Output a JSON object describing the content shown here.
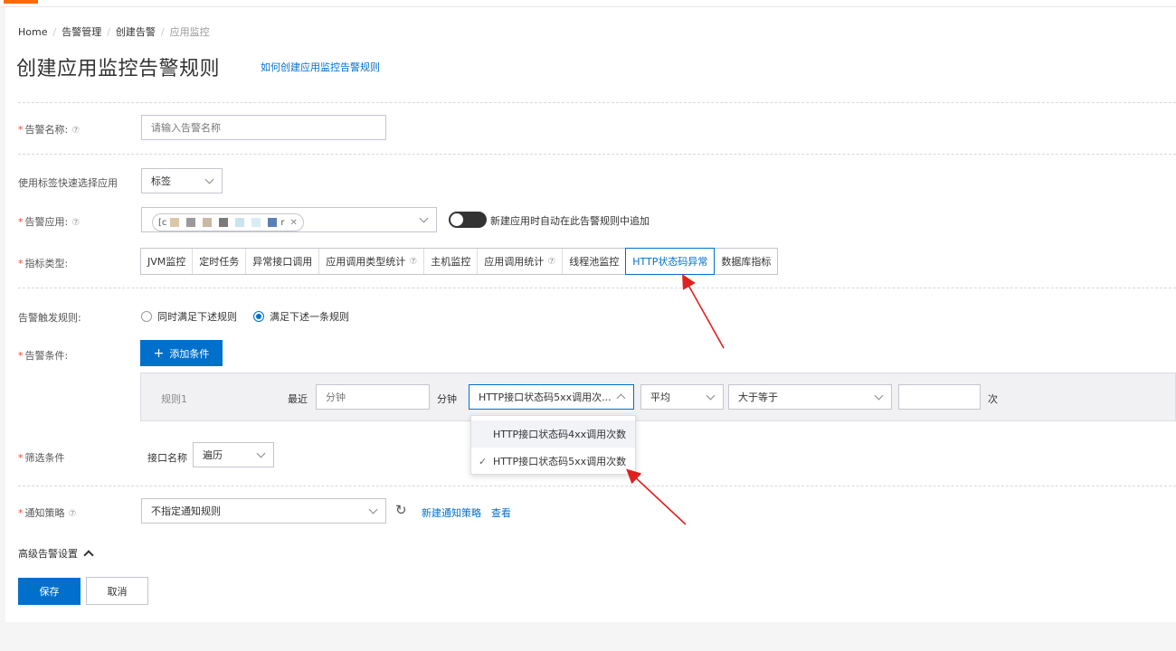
{
  "breadcrumb": {
    "items": [
      "Home",
      "告警管理",
      "创建告警",
      "应用监控"
    ]
  },
  "page": {
    "title": "创建应用监控告警规则",
    "help_link": "如何创建应用监控告警规则"
  },
  "form": {
    "alert_name": {
      "label": "告警名称:",
      "placeholder": "请输入告警名称"
    },
    "tag_select": {
      "label": "使用标签快速选择应用",
      "value": "标签"
    },
    "alert_app": {
      "label": "告警应用:",
      "tag_prefix": "[c",
      "tag_suffix": "r",
      "toggle_label": "新建应用时自动在此告警规则中追加"
    },
    "metric_type": {
      "label": "指标类型:",
      "tabs": [
        "JVM监控",
        "定时任务",
        "异常接口调用",
        "应用调用类型统计",
        "主机监控",
        "应用调用统计",
        "线程池监控",
        "HTTP状态码异常",
        "数据库指标"
      ],
      "active": "HTTP状态码异常"
    },
    "trigger_rule": {
      "label": "告警触发规则:",
      "option_all": "同时满足下述规则",
      "option_any": "满足下述一条规则"
    },
    "condition": {
      "label": "告警条件:",
      "add_button": "添加条件",
      "rule": {
        "name": "规则1",
        "recent_label": "最近",
        "minutes_placeholder": "分钟",
        "minutes_unit": "分钟",
        "metric_value": "HTTP接口状态码5xx调用次...",
        "agg_value": "平均",
        "op_value": "大于等于",
        "count_unit": "次"
      },
      "dropdown_options": [
        "HTTP接口状态码4xx调用次数",
        "HTTP接口状态码5xx调用次数"
      ]
    },
    "filter": {
      "label": "筛选条件",
      "field_label": "接口名称",
      "value": "遍历"
    },
    "notify": {
      "label": "通知策略",
      "value": "不指定通知规则",
      "new_link": "新建通知策略",
      "view_link": "查看"
    },
    "advanced": {
      "label": "高级告警设置"
    }
  },
  "actions": {
    "save": "保存",
    "cancel": "取消"
  },
  "colors": {
    "primary": "#0070cc",
    "required": "#f04134",
    "annotation_arrow": "#e02020"
  }
}
